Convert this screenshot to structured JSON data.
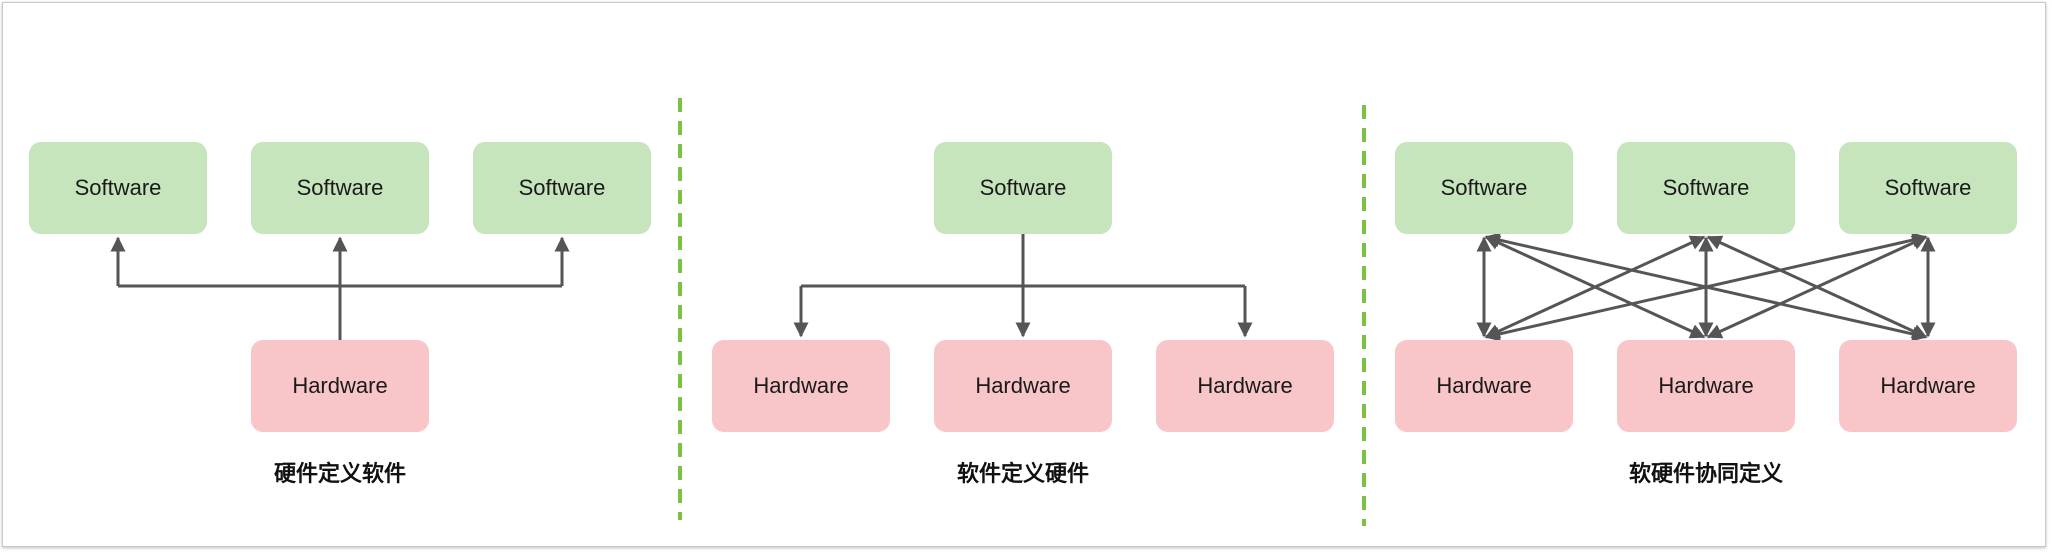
{
  "panels": [
    {
      "caption": "硬件定义软件",
      "top_boxes": [
        "Software",
        "Software",
        "Software"
      ],
      "bottom_boxes": [
        "Hardware"
      ]
    },
    {
      "caption": "软件定义硬件",
      "top_boxes": [
        "Software"
      ],
      "bottom_boxes": [
        "Hardware",
        "Hardware",
        "Hardware"
      ]
    },
    {
      "caption": "软硬件协同定义",
      "top_boxes": [
        "Software",
        "Software",
        "Software"
      ],
      "bottom_boxes": [
        "Hardware",
        "Hardware",
        "Hardware"
      ]
    }
  ],
  "colors": {
    "software_fill": "#c6e5bc",
    "hardware_fill": "#f8c6c8",
    "arrow": "#555555",
    "divider": "#7cc242"
  }
}
